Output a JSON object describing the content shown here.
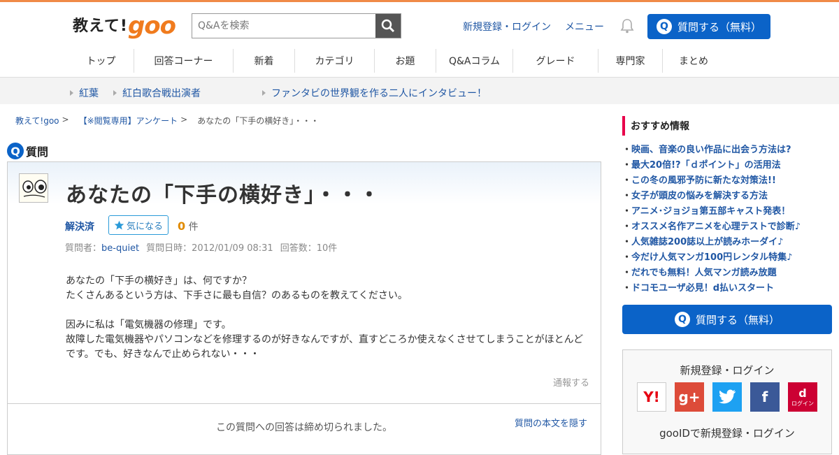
{
  "header": {
    "logo_prefix": "教えて!",
    "logo_brand": "goo",
    "search_placeholder": "Q&Aを検索",
    "signup_login": "新規登録・ログイン",
    "menu": "メニュー",
    "ask_button": "質問する（無料）",
    "ask_icon": "Q"
  },
  "global_nav": [
    "トップ",
    "回答コーナー",
    "新着",
    "カテゴリ",
    "お題",
    "Q&Aコラム",
    "グレード",
    "専門家",
    "まとめ"
  ],
  "sub_nav": [
    "紅葉",
    "紅白歌合戦出演者",
    "ファンタビの世界観を作る二人にインタビュー！"
  ],
  "breadcrumb": [
    "教えて!goo",
    "【※閲覧専用】アンケート",
    "あなたの「下手の横好き」・・・"
  ],
  "breadcrumb_sep": ">",
  "question_section_label": "質問",
  "question": {
    "title": "あなたの「下手の横好き」・・・",
    "status": "解決済",
    "fav_label": "気になる",
    "fav_count": "0",
    "fav_unit": "件",
    "asker_label": "質問者：",
    "asker": "be-quiet",
    "date_label": "質問日時：2012/01/09 08:31",
    "answers_label": "回答数：10件",
    "body": [
      "あなたの「下手の横好き」は、何ですか？",
      "たくさんあるという方は、下手さに最も自信？のあるものを教えてください。",
      "",
      "因みに私は「電気機器の修理」です。",
      "故障した電気機器やパソコンなどを修理するのが好きなんですが、直すどころか使えなくさせてしまうことがほとんどです。でも、好きなんで止められない・・・"
    ],
    "report": "通報する",
    "closed_msg": "この質問への回答は締め切られました。",
    "hide_body": "質問の本文を隠す"
  },
  "sidebar": {
    "rec_title": "おすすめ情報",
    "rec_items": [
      "映画、音楽の良い作品に出会う方法は?",
      "最大20倍!?「ｄポイント」の活用法",
      "この冬の風邪予防に新たな対策法!!",
      "女子が頭皮の悩みを解決する方法",
      "アニメ･ジョジョ第五部キャスト発表！",
      "オススメ名作アニメを心理テストで診断♪",
      "人気雑誌200誌以上が読みホーダイ♪",
      "今だけ人気マンガ100円レンタル特集♪",
      "だれでも無料！人気マンガ読み放題",
      "ドコモユーザ必見！d払いスタート"
    ],
    "ask_button": "質問する（無料）",
    "login_title": "新規登録・ログイン",
    "social": [
      {
        "name": "yahoo",
        "label": "Y!",
        "color": "#ffffff",
        "text": "#e60012"
      },
      {
        "name": "google-plus",
        "label": "g+",
        "color": "#dd4b39",
        "text": "#ffffff"
      },
      {
        "name": "twitter",
        "label": "",
        "color": "#1da1f2",
        "text": "#ffffff"
      },
      {
        "name": "facebook",
        "label": "f",
        "color": "#3b5998",
        "text": "#ffffff"
      },
      {
        "name": "docomo",
        "label": "d",
        "color": "#cc0033",
        "text": "#ffffff"
      }
    ],
    "docomo_sub": "ログイン",
    "gooid_login": "gooIDで新規登録・ログイン"
  },
  "colors": {
    "brand_orange": "#f07b1e",
    "primary_blue": "#0b63c8",
    "link_blue": "#2057a4",
    "accent_pink": "#e8004a"
  }
}
